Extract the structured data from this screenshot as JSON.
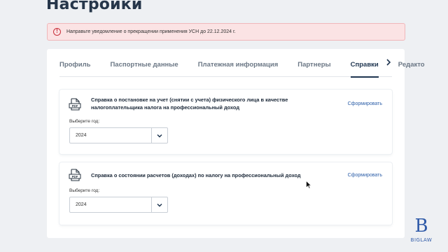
{
  "page": {
    "title": "Настройки"
  },
  "alert": {
    "text": "Направьте уведомление о прекращении применения УСН до 22.12.2024 г.",
    "icon": "alert-circle-icon"
  },
  "tabs": [
    {
      "label": "Профиль",
      "active": false
    },
    {
      "label": "Паспортные данные",
      "active": false
    },
    {
      "label": "Платежная информация",
      "active": false
    },
    {
      "label": "Партнеры",
      "active": false
    },
    {
      "label": "Справки",
      "active": true
    },
    {
      "label": "Редакто",
      "active": false
    }
  ],
  "cards": [
    {
      "icon": "pdf-icon",
      "title": "Справка о постановке на учет (снятии с учета) физического лица в качестве налогоплательщика налога на профессиональный доход",
      "action": "Сформировать",
      "year_label": "Выберите год:",
      "year_value": "2024"
    },
    {
      "icon": "pdf-icon",
      "title": "Справка о состоянии расчетов (доходах) по налогу на профессиональный доход",
      "action": "Сформировать",
      "year_label": "Выберите год:",
      "year_value": "2024"
    }
  ],
  "logo": {
    "mark": "B",
    "text": "BIGLAW"
  },
  "colors": {
    "accent": "#1f3550",
    "link": "#2c5ea8",
    "alert_bg": "#fbe3e4",
    "alert_icon": "#c9323c",
    "logo": "#2f5aa8"
  }
}
